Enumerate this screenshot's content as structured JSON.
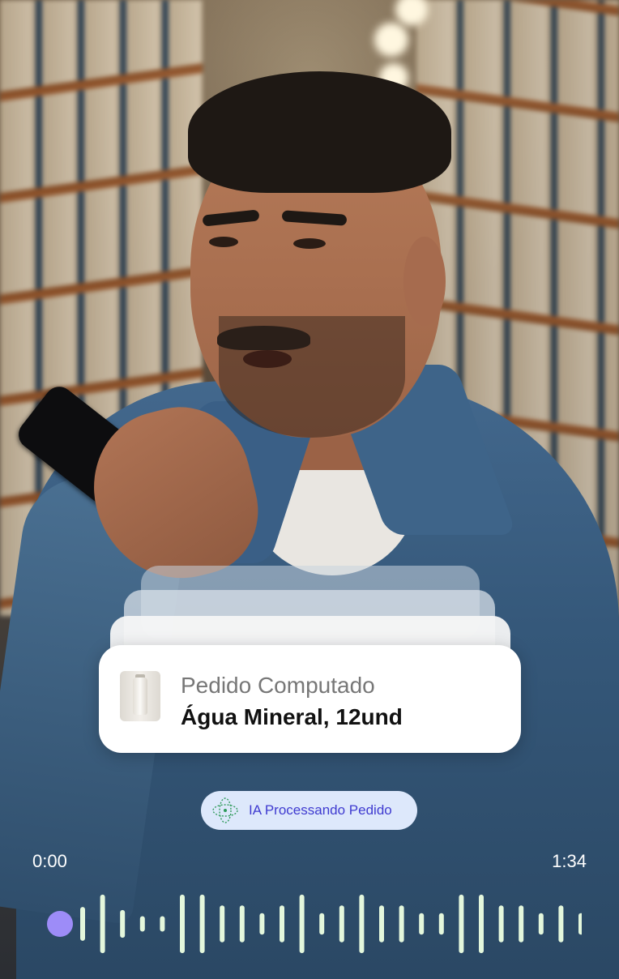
{
  "notification": {
    "title": "Pedido Computado",
    "subtitle": "Água Mineral, 12und"
  },
  "ai_status": {
    "label": "IA Processando Pedido",
    "icon": "ai-orbit-icon"
  },
  "player": {
    "current_time": "0:00",
    "total_time": "1:34",
    "progress": 0,
    "colors": {
      "handle": "#9d8cf8",
      "bars": "#e4f7dc"
    },
    "bar_levels": [
      0.55,
      0.95,
      0.45,
      0.25,
      0.25,
      0.95,
      0.95,
      0.6,
      0.6,
      0.35,
      0.6,
      0.95,
      0.35,
      0.6,
      0.95,
      0.6,
      0.6,
      0.35,
      0.35,
      0.95,
      0.95,
      0.6,
      0.6,
      0.35,
      0.6,
      0.35
    ]
  },
  "colors": {
    "pill_bg": "#dde8fb",
    "pill_text": "#3f3bd0",
    "card_bg": "#ffffff"
  }
}
